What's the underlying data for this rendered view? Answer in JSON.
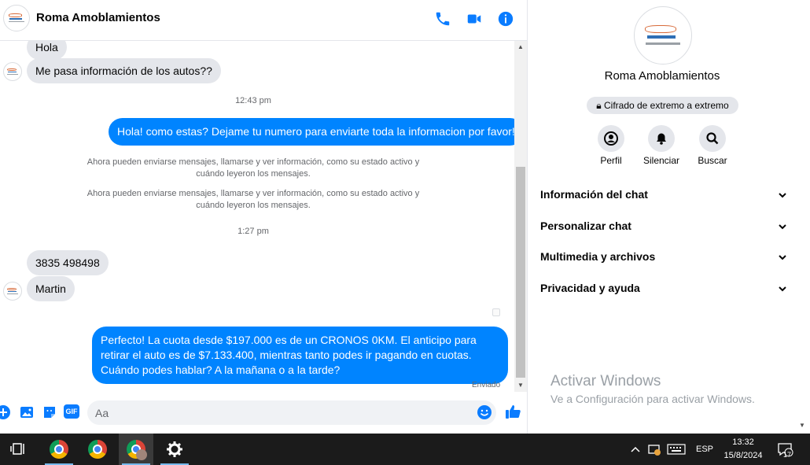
{
  "header": {
    "name": "Roma Amoblamientos",
    "icons": [
      "phone-icon",
      "video-icon",
      "info-icon"
    ]
  },
  "colors": {
    "accent": "#0084ff",
    "icon_blue": "#0a7cff",
    "bubble_in": "#e4e6eb",
    "taskbar": "#1b1b1b"
  },
  "messages": {
    "in_1": "Hola",
    "in_2": "Me pasa información de los autos??",
    "time_1": "12:43 pm",
    "out_1": "Hola! como estas? Dejame tu numero para enviarte toda la informacion por favor!",
    "sys_1": "Ahora pueden enviarse mensajes, llamarse y ver información, como su estado activo y cuándo leyeron los mensajes.",
    "sys_2": "Ahora pueden enviarse mensajes, llamarse y ver información, como su estado activo y cuándo leyeron los mensajes.",
    "time_2": "1:27 pm",
    "in_3": "3835 498498",
    "in_4": "Martin",
    "out_2": "Perfecto! La cuota desde $197.000 es de un CRONOS 0KM. El anticipo para retirar el auto es de $7.133.400, mientras tanto podes ir pagando en cuotas. Cuándo podes hablar? A la mañana o a la tarde?",
    "status": "Enviado"
  },
  "composer": {
    "placeholder": "Aa",
    "icons": [
      "plus-icon",
      "image-icon",
      "sticker-icon",
      "gif-icon",
      "emoji-icon",
      "like-icon"
    ],
    "gif_label": "GIF"
  },
  "info_panel": {
    "name": "Roma Amoblamientos",
    "encryption": "Cifrado de extremo a extremo",
    "actions": [
      {
        "label": "Perfil",
        "icon": "profile-icon"
      },
      {
        "label": "Silenciar",
        "icon": "bell-icon"
      },
      {
        "label": "Buscar",
        "icon": "search-icon"
      }
    ],
    "sections": [
      "Información del chat",
      "Personalizar chat",
      "Multimedia y archivos",
      "Privacidad y ayuda"
    ]
  },
  "watermark": {
    "line1": "Activar Windows",
    "line2": "Ve a Configuración para activar Windows."
  },
  "taskbar": {
    "language": "ESP",
    "time": "13:32",
    "date": "15/8/2024",
    "notifications": "17"
  }
}
